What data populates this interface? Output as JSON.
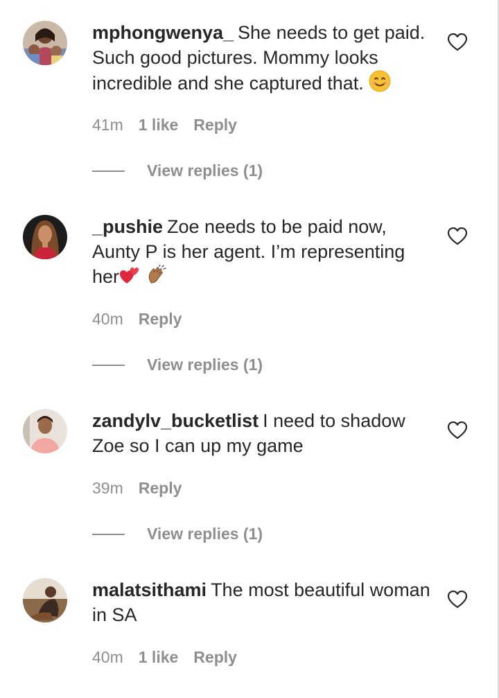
{
  "comments": [
    {
      "username": "mphongwenya_",
      "text": "She needs to get paid. Such good pictures. Mommy looks incredible and she captured that.",
      "emoji_icon": "smiling-face-emoji",
      "time": "41m",
      "likes": "1 like",
      "reply_label": "Reply",
      "view_replies": "View replies (1)"
    },
    {
      "username": "_pushie",
      "text": "Zoe needs to be paid now, Aunty P is her agent. I’m representing her",
      "emoji_icons": [
        "two-hearts-emoji",
        "clapping-hands-emoji"
      ],
      "time": "40m",
      "reply_label": "Reply",
      "view_replies": "View replies (1)"
    },
    {
      "username": "zandylv_bucketlist",
      "text": "I need to shadow Zoe so I can up my game",
      "time": "39m",
      "reply_label": "Reply",
      "view_replies": "View replies (1)"
    },
    {
      "username": "malatsithami",
      "text": "The most beautiful woman in SA",
      "time": "40m",
      "likes": "1 like",
      "reply_label": "Reply"
    }
  ],
  "icons": {
    "like": "heart-outline-icon",
    "avatar": "user-avatar"
  },
  "colors": {
    "text_primary": "#262626",
    "text_secondary": "#8e8e8e",
    "background": "#ffffff"
  }
}
